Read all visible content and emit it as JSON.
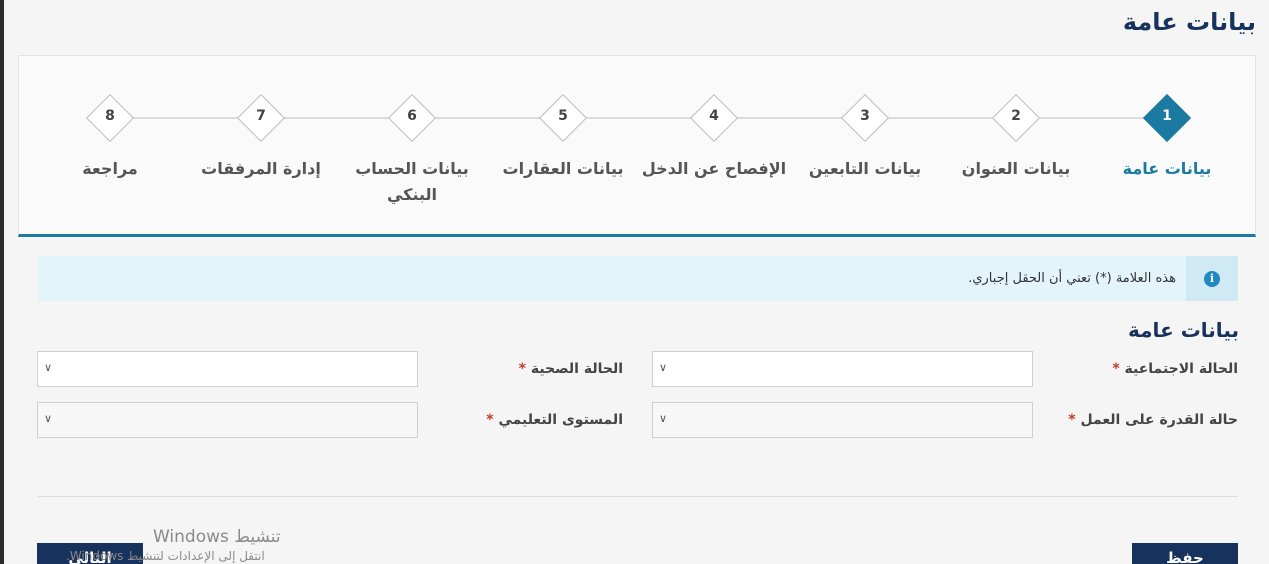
{
  "page_title": "بيانات عامة",
  "steps": [
    {
      "num": "1",
      "label": "بيانات عامة",
      "active": true
    },
    {
      "num": "2",
      "label": "بيانات العنوان"
    },
    {
      "num": "3",
      "label": "بيانات التابعين"
    },
    {
      "num": "4",
      "label": "الإفصاح عن الدخل"
    },
    {
      "num": "5",
      "label": "بيانات العقارات"
    },
    {
      "num": "6",
      "label": "بيانات الحساب البنكي"
    },
    {
      "num": "7",
      "label": "إدارة المرفقات"
    },
    {
      "num": "8",
      "label": "مراجعة"
    }
  ],
  "info": {
    "text": "هذه العلامة (*) تعني أن الحقل إجباري.",
    "icon": "info-icon",
    "color": "#1f8ac0"
  },
  "section_title": "بيانات عامة",
  "fields": {
    "marital_status": {
      "label": "الحالة الاجتماعية",
      "required": "*",
      "value": ""
    },
    "health_status": {
      "label": "الحالة الصحية",
      "required": "*",
      "value": ""
    },
    "work_ability": {
      "label": "حالة القدرة على العمل",
      "required": "*",
      "value": ""
    },
    "education_level": {
      "label": "المستوى التعليمي",
      "required": "*",
      "value": ""
    }
  },
  "buttons": {
    "save": "حفظ",
    "next": "التالي"
  },
  "watermark": {
    "line1": "تنشيط Windows",
    "line2": "انتقل إلى الإعدادات لتنشيط Windows."
  },
  "colors": {
    "accent": "#1a7aa0",
    "brand": "#17325c",
    "required": "#c0392b"
  }
}
